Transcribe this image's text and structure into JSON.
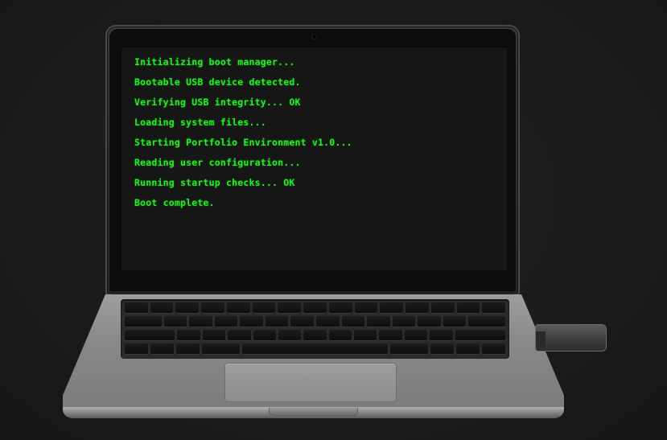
{
  "screen": {
    "boot_lines": [
      "Initializing boot manager...",
      "Bootable USB device detected.",
      "Verifying USB integrity... OK",
      "Loading system files...",
      "Starting Portfolio Environment v1.0...",
      "Reading user configuration...",
      "Running startup checks... OK",
      "Boot complete."
    ],
    "text_color": "#22ee22",
    "background_color": "#161616"
  },
  "icons": {
    "camera": "webcam-dot",
    "usb": "usb-drive"
  }
}
